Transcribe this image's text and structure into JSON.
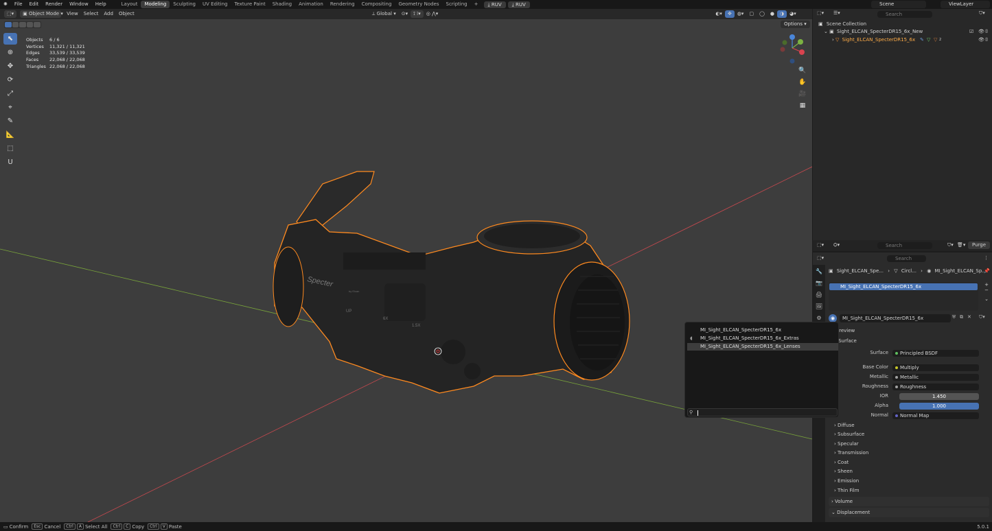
{
  "menu": {
    "items": [
      "File",
      "Edit",
      "Render",
      "Window",
      "Help"
    ]
  },
  "workspaces": {
    "tabs": [
      "Layout",
      "Modeling",
      "Sculpting",
      "UV Editing",
      "Texture Paint",
      "Shading",
      "Animation",
      "Rendering",
      "Compositing",
      "Geometry Nodes",
      "Scripting"
    ],
    "active": "Modeling",
    "extra": [
      "RUV",
      "RUV"
    ]
  },
  "scene": {
    "name": "Scene",
    "view_layer": "ViewLayer"
  },
  "viewport_header": {
    "mode": "Object Mode",
    "menus": [
      "View",
      "Select",
      "Add",
      "Object"
    ],
    "orientation": "Global",
    "options": "Options"
  },
  "stats": {
    "rows": [
      {
        "k": "Objects",
        "v": "6 / 6"
      },
      {
        "k": "Vertices",
        "v": "11,321 / 11,321"
      },
      {
        "k": "Edges",
        "v": "33,539 / 33,539"
      },
      {
        "k": "Faces",
        "v": "22,068 / 22,068"
      },
      {
        "k": "Triangles",
        "v": "22,068 / 22,068"
      }
    ]
  },
  "model_text": {
    "brand": "Specter",
    "sub": "by Elcan",
    "mark_up": "UP",
    "mark_6x": "6X",
    "mark_15x": "1.5X"
  },
  "outliner": {
    "search": "Search",
    "root": "Scene Collection",
    "collection": "Sight_ELCAN_SpecterDR15_6x_New",
    "object": "Sight_ELCAN_SpecterDR15_6x",
    "badge": "2"
  },
  "assets": {
    "search": "Search",
    "purge": "Purge"
  },
  "properties": {
    "search": "Search",
    "breadcrumb": [
      "Sight_ELCAN_Spe...",
      "Circl...",
      "MI_Sight_ELCAN_Sp..."
    ],
    "slot": "MI_Sight_ELCAN_SpecterDR15_6x",
    "material_name": "MI_Sight_ELCAN_SpecterDR15_6x",
    "preview": "Preview",
    "surface_header": "Surface",
    "fields": [
      {
        "label": "Surface",
        "value": "Principled BSDF",
        "dot": "#5fbf5f"
      },
      {
        "label": "Base Color",
        "value": "Multiply",
        "dot": "#c7c729"
      },
      {
        "label": "Metallic",
        "value": "Metallic",
        "dot": "#a1a1a1"
      },
      {
        "label": "Roughness",
        "value": "Roughness",
        "dot": "#a1a1a1"
      },
      {
        "label": "IOR",
        "value": "1.450"
      },
      {
        "label": "Alpha",
        "value": "1.000"
      },
      {
        "label": "Normal",
        "value": "Normal Map",
        "dot": "#6363c7"
      }
    ],
    "sections": [
      "Diffuse",
      "Subsurface",
      "Specular",
      "Transmission",
      "Coat",
      "Sheen",
      "Emission",
      "Thin Film"
    ],
    "volume": "Volume",
    "displacement": "Displacement"
  },
  "popup": {
    "items": [
      "MI_Sight_ELCAN_SpecterDR15_6x",
      "MI_Sight_ELCAN_SpecterDR15_6x_Extras",
      "MI_Sight_ELCAN_SpecterDR15_6x_Lenses"
    ]
  },
  "statusbar": {
    "items": [
      {
        "key": "",
        "label": "Confirm"
      },
      {
        "key": "Esc",
        "label": "Cancel"
      },
      {
        "key": "Ctrl",
        "key2": "A",
        "label": "Select All"
      },
      {
        "key": "Ctrl",
        "key2": "C",
        "label": "Copy"
      },
      {
        "key": "Ctrl",
        "key2": "V",
        "label": "Paste"
      }
    ],
    "version": "5.0.1"
  },
  "colors": {
    "accent": "#4772b3",
    "selection": "#ff8a1f",
    "viewport": "#3d3d3d",
    "x_axis": "#c8494f",
    "y_axis": "#7aa63a"
  }
}
